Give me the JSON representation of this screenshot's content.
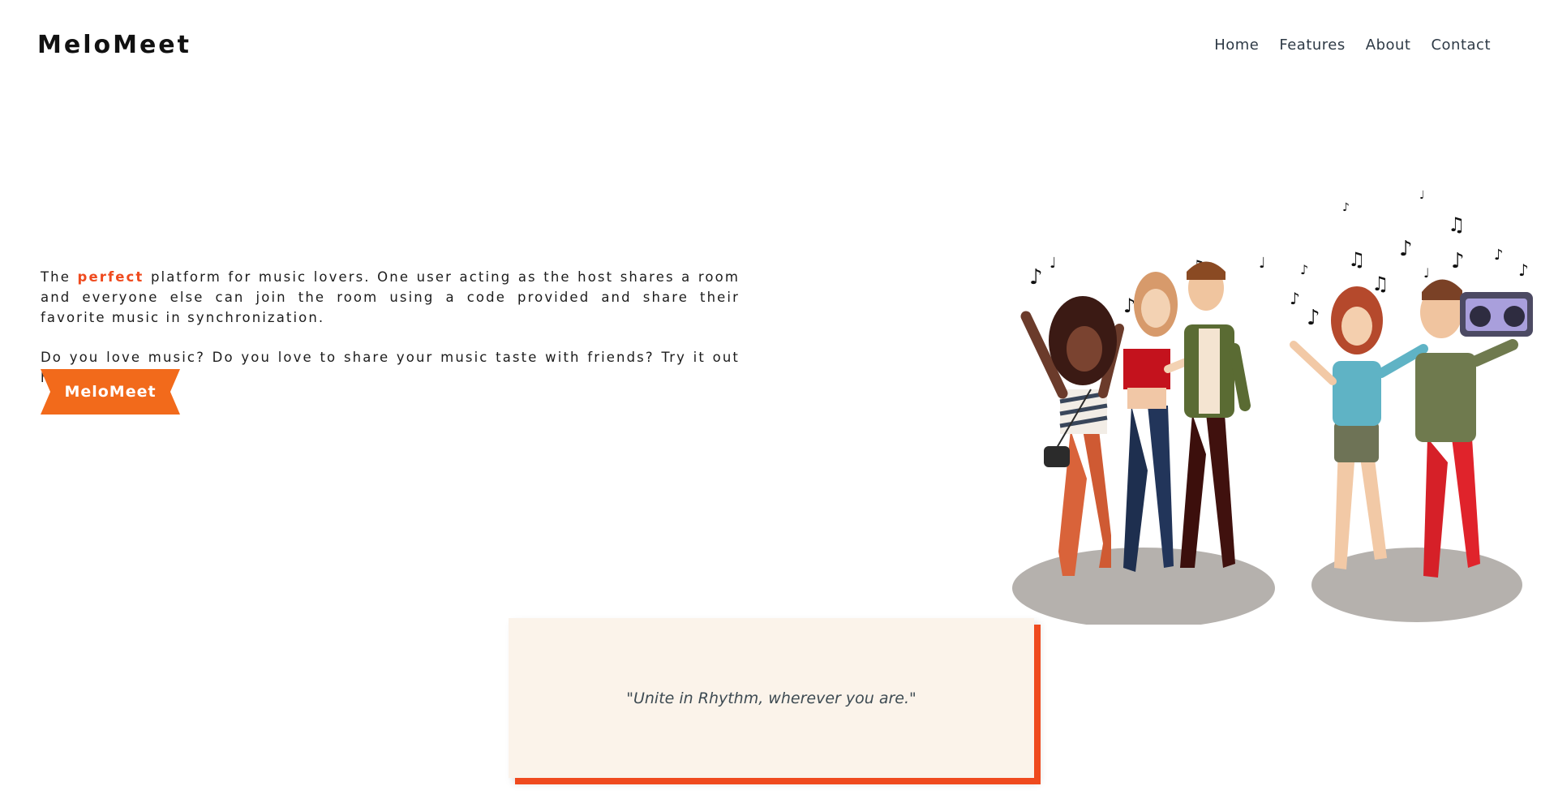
{
  "header": {
    "logo": "MeloMeet",
    "nav": [
      "Home",
      "Features",
      "About",
      "Contact"
    ]
  },
  "hero": {
    "paragraph1": {
      "before": "The ",
      "highlight": "perfect",
      "after": " platform for music lovers. One user acting as the host shares a room and everyone else can join the room using a code provided and share their favorite music in synchronization."
    },
    "paragraph2": "Do you love music? Do you love to share your music taste with friends? Try it out here",
    "cta_label": "MeloMeet"
  },
  "quote": {
    "text": "\"Unite in Rhythm, wherever you are.\""
  },
  "colors": {
    "accent": "#ef4a1e",
    "cta_bg": "#f26a1b",
    "quote_bg": "#fbf3ea"
  },
  "illustration": {
    "icon": "friends-dancing-music-illustration"
  }
}
